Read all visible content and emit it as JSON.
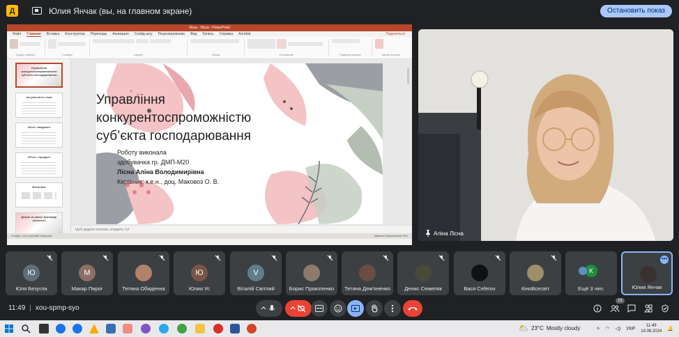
{
  "topbar": {
    "app_icon_letter": "Д",
    "title": "Юлия Янчак (вы, на главном экране)",
    "stop_button": "Остановить показ"
  },
  "powerpoint": {
    "window_title": "Ясна - Лісна - PowerPoint",
    "tabs": [
      "Файл",
      "Главная",
      "Вставка",
      "Конструктор",
      "Переходы",
      "Анимация",
      "Слайд-шоу",
      "Рецензирование",
      "Вид",
      "Запись",
      "Справка",
      "Acrobat"
    ],
    "active_tab": "Главная",
    "share_label": "Поделиться",
    "ribbon_groups": [
      "Буфер обмена",
      "Слайды",
      "Шрифт",
      "Абзац",
      "Рисование",
      "Редактирование",
      "Adobe Acrobat"
    ],
    "thumbnails": [
      {
        "num": "1",
        "title": "Управління конкурентоспроможністю суб'єкта господарювання"
      },
      {
        "num": "2",
        "title": "Актуальність теми"
      },
      {
        "num": "3",
        "title": "Мета і завдання"
      },
      {
        "num": "4",
        "title": "Об'єкт і предмет"
      },
      {
        "num": "5",
        "title": "Висновки"
      },
      {
        "num": "6",
        "title": "Дякую за увагу! Доповідь закінчено"
      }
    ],
    "slide": {
      "title_line1": "Управління",
      "title_line2": "конкурентоспроможністю",
      "title_line3": "суб’єкта господарювання",
      "line1": "Роботу виконала",
      "line2": "здобувачка гр. ДМП-М20",
      "line3": "Лісна Аліна Володимирівна",
      "line4": "Керівник: к.е.н., доц. Маковоз О. В."
    },
    "notes_placeholder": "Щоб додати нотатки, клацніть тут",
    "status_left": "Слайд 1 из 6   русский (Украина)",
    "status_right": "Заметки   Примечания   75%"
  },
  "camera": {
    "name": "Аліна Лісна"
  },
  "participants": [
    {
      "name": "Юля Безугла",
      "initial": "Ю",
      "color": "#5f6f7a",
      "muted": true
    },
    {
      "name": "Макар Пирог",
      "initial": "М",
      "color": "#8d6e63",
      "muted": true
    },
    {
      "name": "Тетяна Обиденна",
      "initial": "",
      "color": "#b3826a",
      "muted": true
    },
    {
      "name": "Юлия Ус",
      "initial": "Ю",
      "color": "#795548",
      "muted": true
    },
    {
      "name": "Віталій Світлий",
      "initial": "V",
      "color": "#607d8b",
      "muted": true
    },
    {
      "name": "Борис Прокопенко",
      "initial": "",
      "color": "#8c7b6b",
      "muted": true
    },
    {
      "name": "Тетяна Дем'яненко",
      "initial": "",
      "color": "#6d4c41",
      "muted": true
    },
    {
      "name": "Денис Семеляк",
      "initial": "",
      "color": "#4a4a3a",
      "muted": true
    },
    {
      "name": "Вася Ceferov",
      "initial": "",
      "color": "#111111",
      "muted": true
    },
    {
      "name": "КіноВсесвіт",
      "initial": "",
      "color": "#9e8f6a",
      "muted": true
    },
    {
      "name": "Ещё 3 чел.",
      "initial": "K",
      "color": "#1e8e3e",
      "muted": false
    },
    {
      "name": "Юлия Янчак",
      "initial": "",
      "color": "#3a3030",
      "muted": false
    }
  ],
  "controls": {
    "time": "11:49",
    "meeting_code": "xou-spmp-syo",
    "participant_count": "16"
  },
  "taskbar": {
    "temperature": "23°C",
    "weather": "Mostly cloudy",
    "language": "УКР",
    "time": "11:49",
    "date": "14.06.2024"
  }
}
